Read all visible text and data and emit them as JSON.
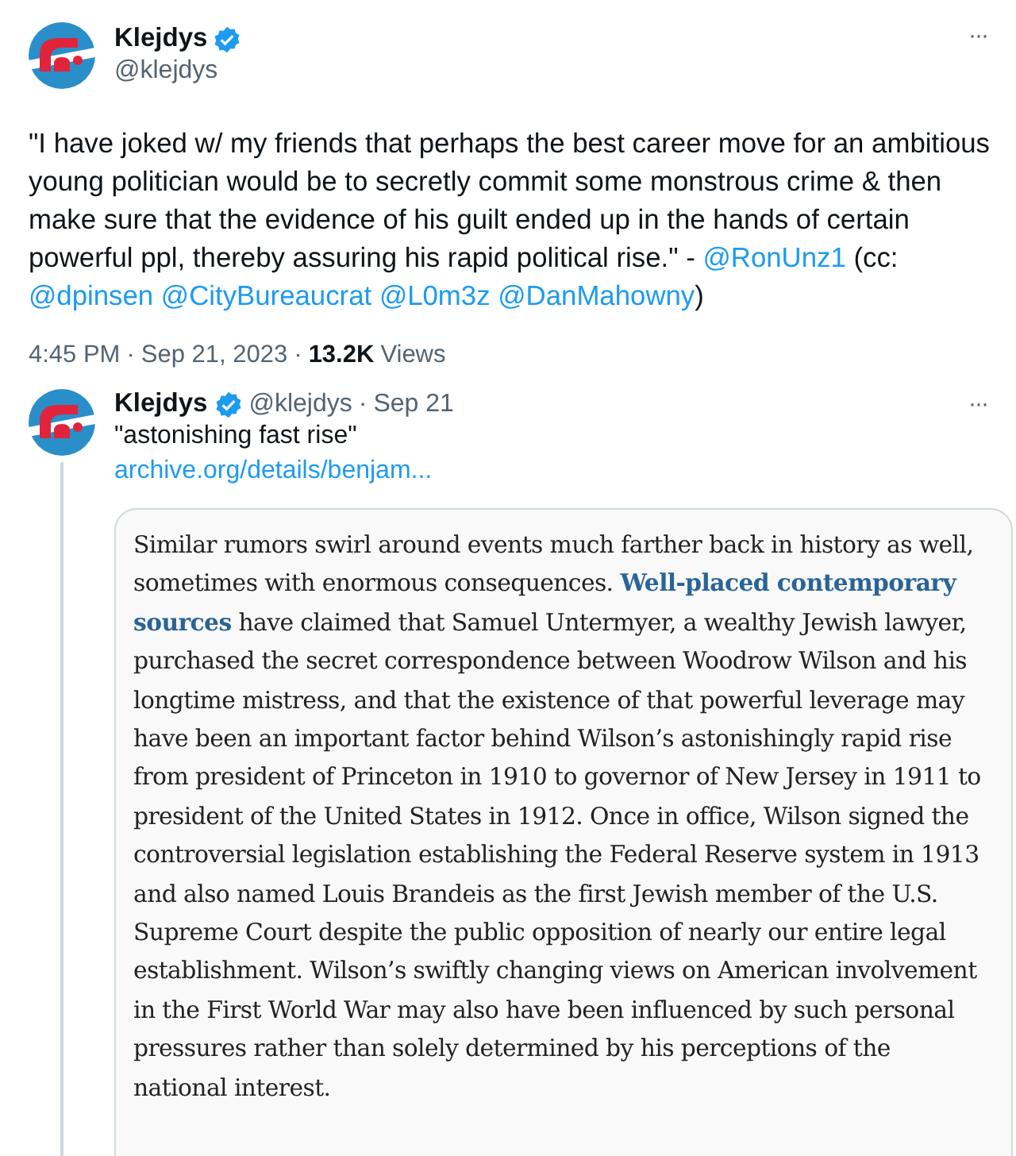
{
  "tweet": {
    "author": {
      "name": "Klejdys",
      "verified": true,
      "handle": "@klejdys"
    },
    "text": "\"I have joked w/ my friends that perhaps the best career move for an ambitious young politician would be to secretly commit some monstrous crime & then make sure that the evidence of his guilt ended up in the hands of certain powerful ppl, thereby assuring his rapid political rise.\" -",
    "mentions_prefix": "@RonUnz1",
    "mentions_text": "(cc:",
    "mentions": [
      "@dpinsen",
      "@CityBureaucrat",
      "@L0m3z",
      "@DanMahowny"
    ],
    "mentions_suffix": ")",
    "separator": "·",
    "time": "4:45 PM",
    "date": "Sep 21, 2023",
    "views_count": "13.2K",
    "views_label": "Views",
    "more": "···"
  },
  "reply": {
    "author": {
      "name": "Klejdys",
      "verified": true,
      "handle": "@klejdys",
      "date": "Sep 21"
    },
    "separator": "·",
    "more": "···",
    "text": "\"astonishing fast rise\"",
    "link": "archive.org/details/benjam...",
    "excerpt": "Similar rumors swirl around events much farther back in history as well, sometimes with enormous consequences. **Well-placed contemporary sources** have claimed that Samuel Untermyer, a wealthy Jewish lawyer, purchased the secret correspondence between Woodrow Wilson and his longtime mistress, and that the existence of that powerful leverage may have been an important factor behind Wilson’s astonishingly rapid rise from president of Princeton in 1910 to governor of New Jersey in 1911 to president of the United States in 1912. Once in office, Wilson signed the controversial legislation establishing the Federal Reserve system in 1913 and also named Louis Brandeis as the first Jewish member of the U.S. Supreme Court despite the public opposition of nearly our entire legal establishment. Wilson’s swiftly changing views on American involvement in the First World War may also have been influenced by such personal pressures rather than solely determined by his perceptions of the national interest."
  }
}
